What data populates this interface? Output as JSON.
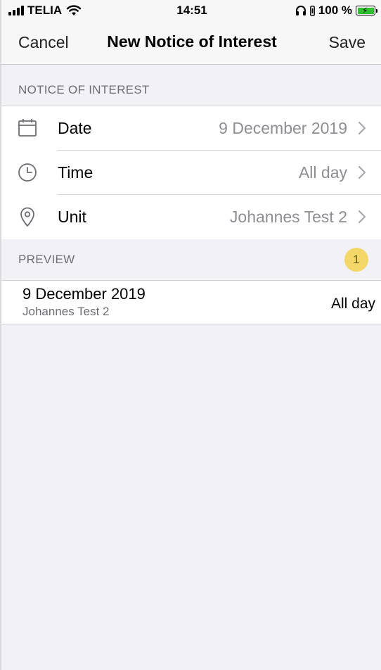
{
  "status_bar": {
    "carrier": "TELIA",
    "time": "14:51",
    "battery_percent": "100 %",
    "battery_level": 1.0,
    "battery_color": "#2fbf2f",
    "icons": [
      "signal-icon",
      "wifi-icon",
      "headphones-icon",
      "lock-rotation-icon",
      "battery-icon"
    ]
  },
  "nav": {
    "cancel_label": "Cancel",
    "title": "New Notice of Interest",
    "save_label": "Save"
  },
  "section": {
    "header": "NOTICE OF INTEREST",
    "rows": [
      {
        "icon": "calendar-icon",
        "label": "Date",
        "value": "9 December 2019"
      },
      {
        "icon": "clock-icon",
        "label": "Time",
        "value": "All day"
      },
      {
        "icon": "location-pin-icon",
        "label": "Unit",
        "value": "Johannes Test 2"
      }
    ]
  },
  "preview": {
    "header": "PREVIEW",
    "badge_count": "1",
    "badge_color": "#f3d769",
    "item": {
      "date": "9 December 2019",
      "unit": "Johannes Test 2",
      "time": "All day"
    }
  }
}
